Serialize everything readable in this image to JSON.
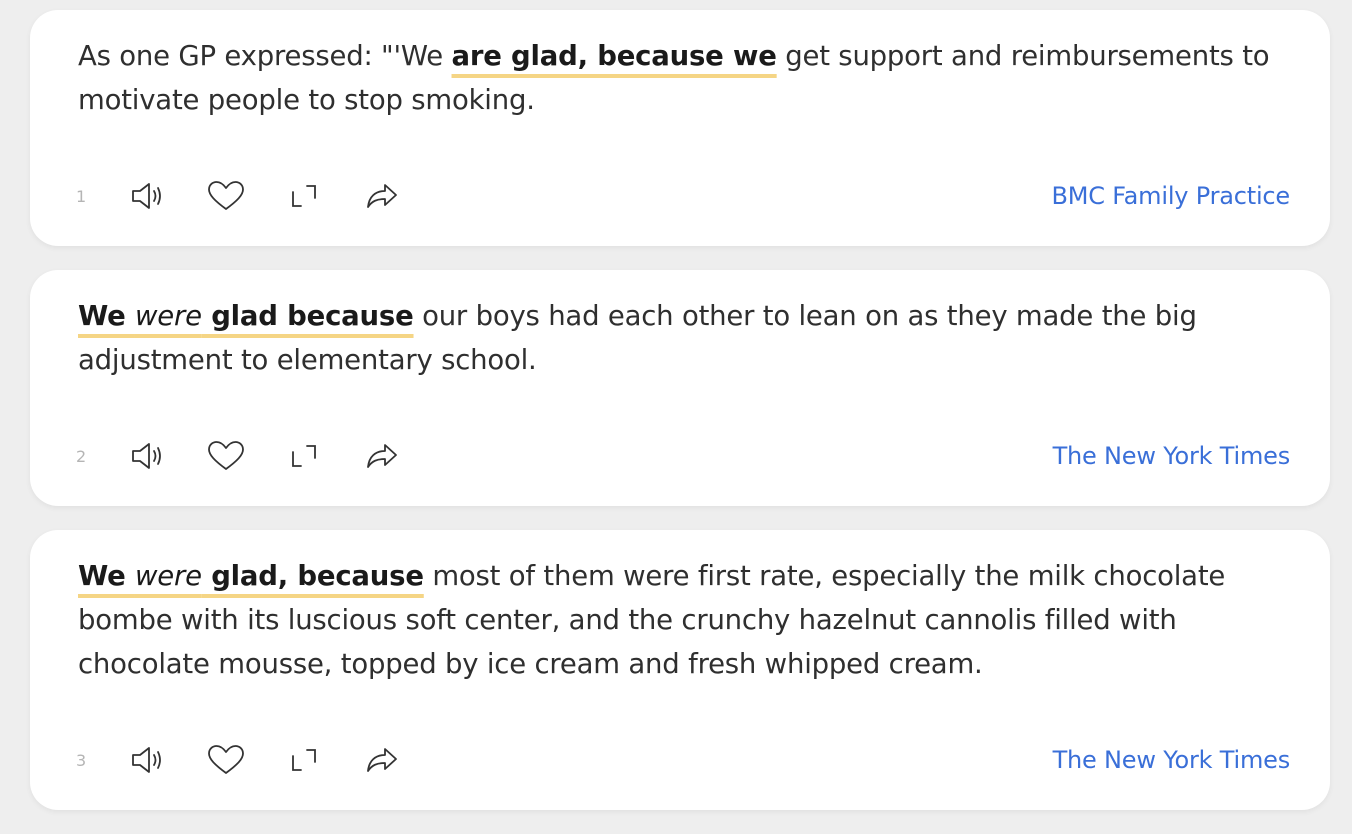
{
  "results": [
    {
      "number": "1",
      "before": "As one GP expressed: \"'We ",
      "highlight": [
        "are glad, because we"
      ],
      "after": " get support and reimbursements to motivate people to stop smoking.",
      "source": "BMC Family Practice"
    },
    {
      "number": "2",
      "before": "",
      "highlight": [
        "We ",
        "were",
        " glad because"
      ],
      "after": " our boys had each other to lean on as they made the big adjustment to elementary school.",
      "source": "The New York Times"
    },
    {
      "number": "3",
      "before": "",
      "highlight": [
        "We ",
        "were",
        " glad, because"
      ],
      "after": " most of them were first rate, especially the milk chocolate bombe with its luscious soft center, and the crunchy hazelnut cannolis filled with chocolate mousse, topped by ice cream and fresh whipped cream.",
      "source": "The New York Times"
    }
  ],
  "icons": {
    "listen": "speaker-icon",
    "like": "heart-icon",
    "expand": "expand-icon",
    "share": "share-icon"
  },
  "colors": {
    "background": "#eeeeee",
    "card": "#ffffff",
    "highlight_underline": "#f5d585",
    "source_link": "#3a6fd8"
  }
}
